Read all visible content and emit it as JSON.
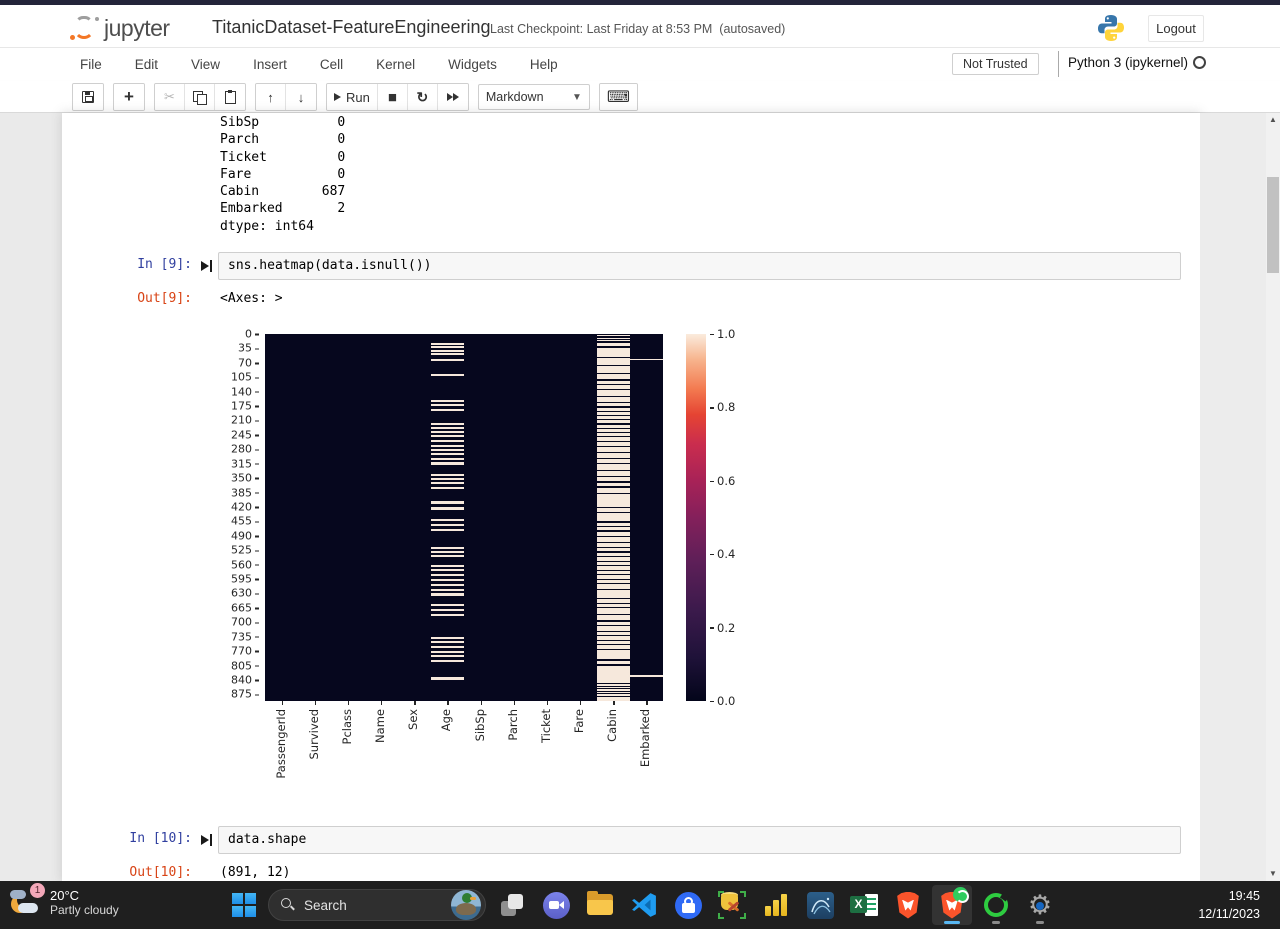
{
  "header": {
    "logo_text": "jupyter",
    "title": "TitanicDataset-FeatureEngineering",
    "checkpoint": "Last Checkpoint: Last Friday at 8:53 PM",
    "autosaved": "(autosaved)",
    "logout_label": "Logout"
  },
  "menubar": {
    "items": [
      "File",
      "Edit",
      "View",
      "Insert",
      "Cell",
      "Kernel",
      "Widgets",
      "Help"
    ],
    "trust_badge": "Not Trusted",
    "kernel_name": "Python 3 (ipykernel)"
  },
  "toolbar": {
    "run_label": "Run",
    "cell_type": "Markdown"
  },
  "notebook": {
    "text_output_lines": [
      "SibSp          0",
      "Parch          0",
      "Ticket         0",
      "Fare           0",
      "Cabin        687",
      "Embarked       2",
      "dtype: int64"
    ],
    "cells": [
      {
        "in_prompt": "In [9]:",
        "code": "sns.heatmap(data.isnull())",
        "out_prompt": "Out[9]:",
        "output": "<Axes: >"
      },
      {
        "in_prompt": "In [10]:",
        "code": "data.shape",
        "out_prompt": "Out[10]:",
        "output": "(891, 12)"
      }
    ]
  },
  "chart_data": {
    "type": "heatmap",
    "title": "",
    "description": "seaborn heatmap of data.isnull(); missing values (True) light, present (False) dark; rocket colormap",
    "columns": [
      "PassengerId",
      "Survived",
      "Pclass",
      "Name",
      "Sex",
      "Age",
      "SibSp",
      "Parch",
      "Ticket",
      "Fare",
      "Cabin",
      "Embarked"
    ],
    "n_rows": 891,
    "yticks": [
      0,
      35,
      70,
      105,
      140,
      175,
      210,
      245,
      280,
      315,
      350,
      385,
      420,
      455,
      490,
      525,
      560,
      595,
      630,
      665,
      700,
      735,
      770,
      805,
      840,
      875
    ],
    "colorbar_ticks": [
      "1.0",
      "0.8",
      "0.6",
      "0.4",
      "0.2",
      "0.0"
    ],
    "colormap": "rocket",
    "color_false": "#06071e",
    "color_true": "#f6e8dc",
    "missing_counts_visible": {
      "SibSp": 0,
      "Parch": 0,
      "Ticket": 0,
      "Fare": 0,
      "Cabin": 687,
      "Embarked": 2
    },
    "age_missing_bands": [
      [
        22,
        5
      ],
      [
        30,
        5
      ],
      [
        38,
        5
      ],
      [
        46,
        5
      ],
      [
        60,
        5
      ],
      [
        97,
        6
      ],
      [
        160,
        5
      ],
      [
        170,
        5
      ],
      [
        182,
        5
      ],
      [
        216,
        5
      ],
      [
        226,
        5
      ],
      [
        236,
        5
      ],
      [
        246,
        5
      ],
      [
        258,
        5
      ],
      [
        270,
        5
      ],
      [
        280,
        5
      ],
      [
        290,
        5
      ],
      [
        300,
        5
      ],
      [
        310,
        9
      ],
      [
        340,
        5
      ],
      [
        350,
        5
      ],
      [
        360,
        5
      ],
      [
        372,
        5
      ],
      [
        405,
        8
      ],
      [
        420,
        8
      ],
      [
        450,
        5
      ],
      [
        462,
        5
      ],
      [
        474,
        5
      ],
      [
        516,
        5
      ],
      [
        526,
        5
      ],
      [
        536,
        5
      ],
      [
        560,
        5
      ],
      [
        570,
        5
      ],
      [
        582,
        5
      ],
      [
        594,
        5
      ],
      [
        606,
        5
      ],
      [
        618,
        5
      ],
      [
        630,
        5
      ],
      [
        656,
        5
      ],
      [
        668,
        5
      ],
      [
        680,
        5
      ],
      [
        736,
        5
      ],
      [
        746,
        5
      ],
      [
        758,
        5
      ],
      [
        770,
        5
      ],
      [
        780,
        5
      ],
      [
        792,
        5
      ],
      [
        833,
        6
      ]
    ],
    "cabin_present_bands": [
      [
        0,
        3
      ],
      [
        6,
        3
      ],
      [
        12,
        3
      ],
      [
        18,
        3
      ],
      [
        30,
        2
      ],
      [
        55,
        3
      ],
      [
        75,
        3
      ],
      [
        95,
        3
      ],
      [
        110,
        3
      ],
      [
        122,
        3
      ],
      [
        133,
        3
      ],
      [
        150,
        4
      ],
      [
        165,
        3
      ],
      [
        176,
        3
      ],
      [
        187,
        3
      ],
      [
        197,
        3
      ],
      [
        207,
        3
      ],
      [
        217,
        3
      ],
      [
        227,
        3
      ],
      [
        237,
        3
      ],
      [
        247,
        3
      ],
      [
        260,
        3
      ],
      [
        272,
        3
      ],
      [
        286,
        4
      ],
      [
        300,
        3
      ],
      [
        312,
        3
      ],
      [
        330,
        3
      ],
      [
        345,
        3
      ],
      [
        358,
        3
      ],
      [
        370,
        3
      ],
      [
        385,
        3
      ],
      [
        420,
        3
      ],
      [
        432,
        3
      ],
      [
        455,
        3
      ],
      [
        466,
        3
      ],
      [
        477,
        3
      ],
      [
        490,
        3
      ],
      [
        505,
        3
      ],
      [
        516,
        3
      ],
      [
        528,
        3
      ],
      [
        539,
        3
      ],
      [
        550,
        3
      ],
      [
        561,
        3
      ],
      [
        572,
        3
      ],
      [
        583,
        3
      ],
      [
        594,
        3
      ],
      [
        605,
        3
      ],
      [
        618,
        3
      ],
      [
        640,
        3
      ],
      [
        652,
        3
      ],
      [
        663,
        3
      ],
      [
        680,
        3
      ],
      [
        695,
        3
      ],
      [
        706,
        3
      ],
      [
        720,
        3
      ],
      [
        731,
        3
      ],
      [
        742,
        3
      ],
      [
        753,
        3
      ],
      [
        764,
        3
      ],
      [
        790,
        3
      ],
      [
        802,
        3
      ],
      [
        848,
        2
      ],
      [
        854,
        2
      ],
      [
        860,
        2
      ],
      [
        866,
        2
      ],
      [
        872,
        2
      ],
      [
        879,
        2
      ]
    ],
    "embarked_missing_rows": [
      61,
      829
    ]
  },
  "taskbar": {
    "weather": {
      "temperature": "20°C",
      "condition": "Partly cloudy",
      "badge": "1"
    },
    "search_label": "Search",
    "clock": {
      "time": "19:45",
      "date": "12/11/2023"
    },
    "pinned_icons": [
      "start",
      "task-view",
      "chat",
      "file-explorer",
      "vscode",
      "lock-app",
      "db-tools",
      "power-bi",
      "database-admin",
      "excel",
      "brave",
      "brave-active",
      "green-ring-capture",
      "settings"
    ]
  }
}
